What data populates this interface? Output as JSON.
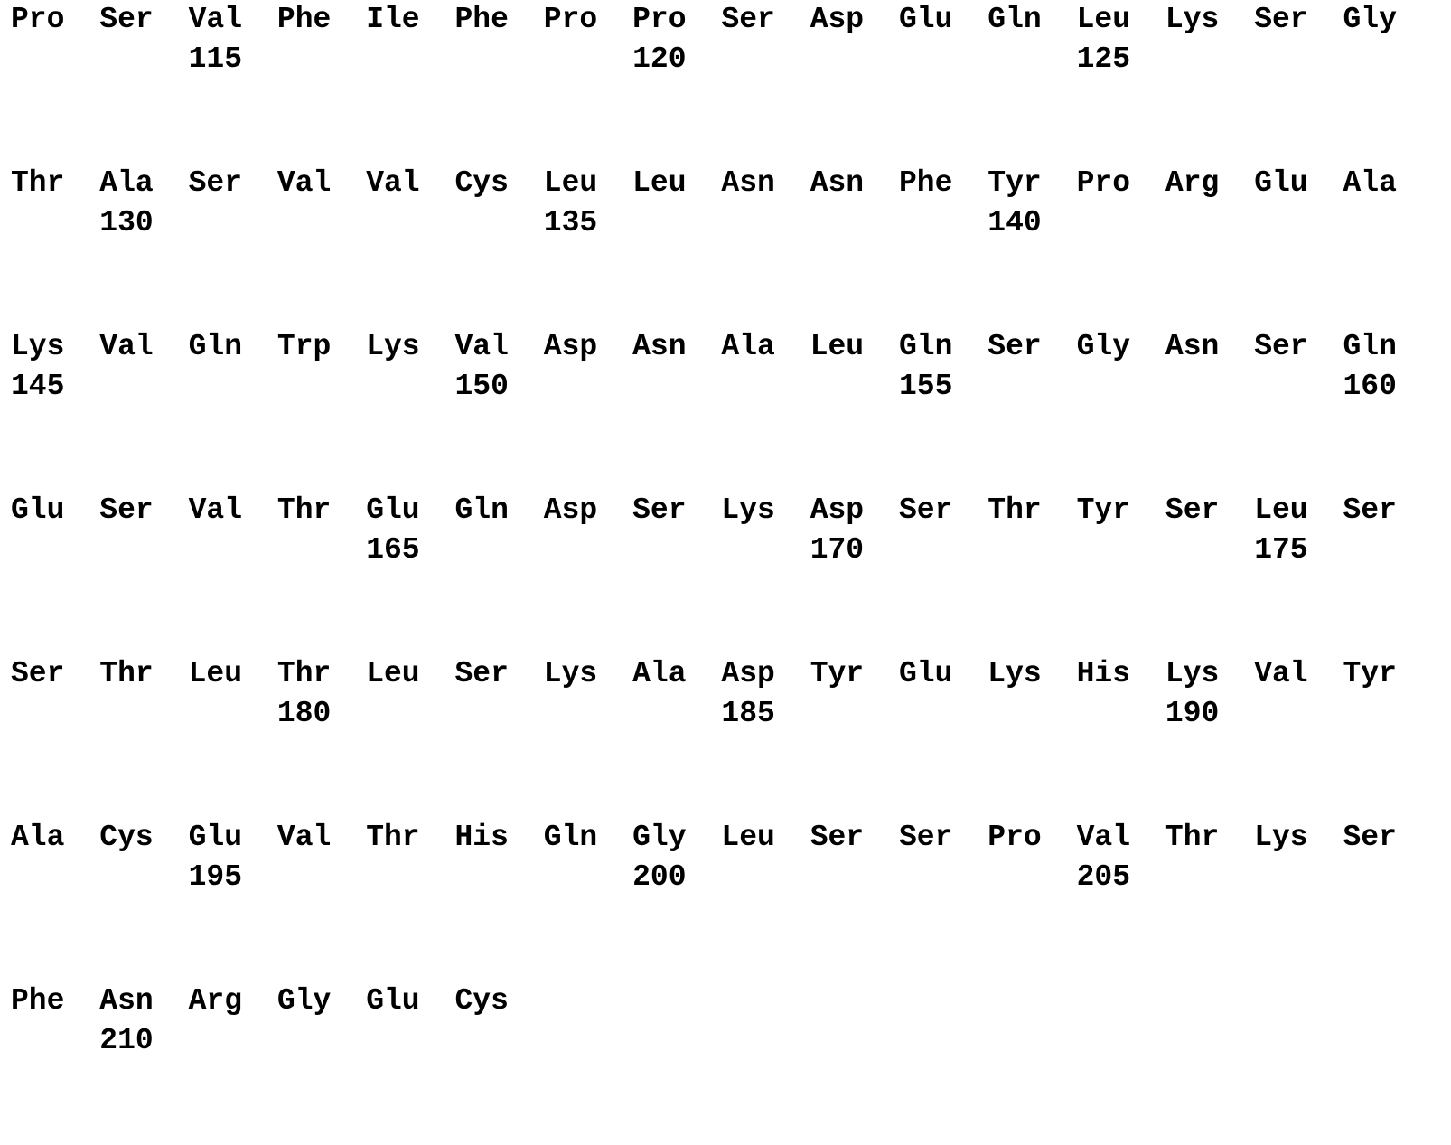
{
  "rows": [
    {
      "residues": [
        "Pro",
        "Ser",
        "Val",
        "Phe",
        "Ile",
        "Phe",
        "Pro",
        "Pro",
        "Ser",
        "Asp",
        "Glu",
        "Gln",
        "Leu",
        "Lys",
        "Ser",
        "Gly"
      ],
      "numbers": [
        {
          "col": 2,
          "text": "115"
        },
        {
          "col": 7,
          "text": "120"
        },
        {
          "col": 12,
          "text": "125"
        }
      ]
    },
    {
      "residues": [
        "Thr",
        "Ala",
        "Ser",
        "Val",
        "Val",
        "Cys",
        "Leu",
        "Leu",
        "Asn",
        "Asn",
        "Phe",
        "Tyr",
        "Pro",
        "Arg",
        "Glu",
        "Ala"
      ],
      "numbers": [
        {
          "col": 1,
          "text": "130"
        },
        {
          "col": 6,
          "text": "135"
        },
        {
          "col": 11,
          "text": "140"
        }
      ]
    },
    {
      "residues": [
        "Lys",
        "Val",
        "Gln",
        "Trp",
        "Lys",
        "Val",
        "Asp",
        "Asn",
        "Ala",
        "Leu",
        "Gln",
        "Ser",
        "Gly",
        "Asn",
        "Ser",
        "Gln"
      ],
      "numbers": [
        {
          "col": 0,
          "text": "145"
        },
        {
          "col": 5,
          "text": "150"
        },
        {
          "col": 10,
          "text": "155"
        },
        {
          "col": 15,
          "text": "160"
        }
      ]
    },
    {
      "residues": [
        "Glu",
        "Ser",
        "Val",
        "Thr",
        "Glu",
        "Gln",
        "Asp",
        "Ser",
        "Lys",
        "Asp",
        "Ser",
        "Thr",
        "Tyr",
        "Ser",
        "Leu",
        "Ser"
      ],
      "numbers": [
        {
          "col": 4,
          "text": "165"
        },
        {
          "col": 9,
          "text": "170"
        },
        {
          "col": 14,
          "text": "175"
        }
      ]
    },
    {
      "residues": [
        "Ser",
        "Thr",
        "Leu",
        "Thr",
        "Leu",
        "Ser",
        "Lys",
        "Ala",
        "Asp",
        "Tyr",
        "Glu",
        "Lys",
        "His",
        "Lys",
        "Val",
        "Tyr"
      ],
      "numbers": [
        {
          "col": 3,
          "text": "180"
        },
        {
          "col": 8,
          "text": "185"
        },
        {
          "col": 13,
          "text": "190"
        }
      ]
    },
    {
      "residues": [
        "Ala",
        "Cys",
        "Glu",
        "Val",
        "Thr",
        "His",
        "Gln",
        "Gly",
        "Leu",
        "Ser",
        "Ser",
        "Pro",
        "Val",
        "Thr",
        "Lys",
        "Ser"
      ],
      "numbers": [
        {
          "col": 2,
          "text": "195"
        },
        {
          "col": 7,
          "text": "200"
        },
        {
          "col": 12,
          "text": "205"
        }
      ]
    },
    {
      "residues": [
        "Phe",
        "Asn",
        "Arg",
        "Gly",
        "Glu",
        "Cys"
      ],
      "numbers": [
        {
          "col": 1,
          "text": "210"
        }
      ]
    }
  ]
}
